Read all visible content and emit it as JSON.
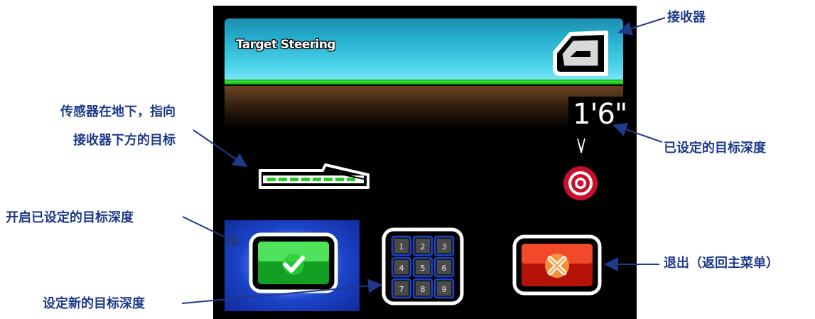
{
  "screen": {
    "title": "Target Steering",
    "depth_value": "1'6\"",
    "keypad_keys": [
      "1",
      "2",
      "3",
      "4",
      "5",
      "6",
      "7",
      "8",
      "9"
    ]
  },
  "annotations": {
    "receiver": "接收器",
    "sensor_line1": "传感器在地下，指向",
    "sensor_line2": "接收器下方的目标",
    "preset_depth": "已设定的目标深度",
    "enable_preset": "开启已设定的目标深度",
    "exit": "退出（返回主菜单）",
    "set_new_depth": "设定新的目标深度"
  },
  "colors": {
    "header_cyan": "#27b0cf",
    "ground_line_green": "#2cf52c",
    "annotation_blue": "#1f3a8a",
    "confirm_green": "#20c030",
    "exit_red": "#e02010",
    "keypad_blue": "#1c44c8",
    "target_red": "#c8102e"
  },
  "icons": {
    "receiver": "receiver-icon",
    "probe": "sensor-probe-icon",
    "target": "target-icon",
    "confirm": "check-icon",
    "keypad": "keypad-icon",
    "exit": "close-x-icon",
    "depth_pointer": "down-arrow-icon"
  }
}
